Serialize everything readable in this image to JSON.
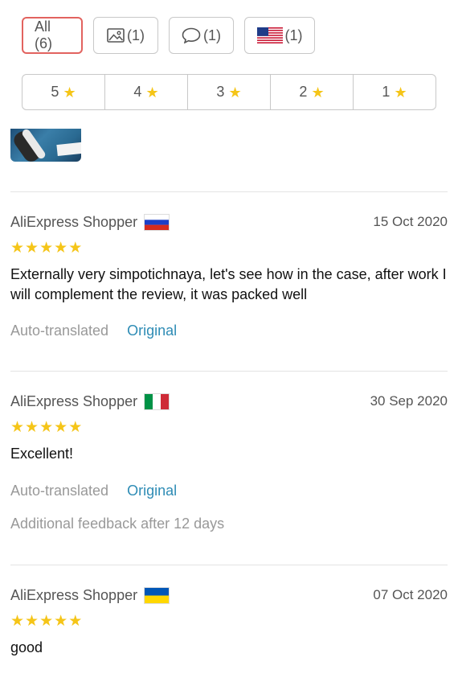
{
  "filters": {
    "all_label": "All (6)",
    "image_count": "(1)",
    "comment_count": "(1)",
    "flag_count": "(1)"
  },
  "ratings": [
    "5",
    "4",
    "3",
    "2",
    "1"
  ],
  "reviews": [
    {
      "name": "AliExpress Shopper",
      "country": "RU",
      "date": "15 Oct 2020",
      "stars": 5,
      "text": "Externally very simpotichnaya, let's see how in the case, after work I will complement the review, it was packed well",
      "auto_translated": "Auto-translated",
      "original": "Original"
    },
    {
      "name": "AliExpress Shopper",
      "country": "IT",
      "date": "30 Sep 2020",
      "stars": 5,
      "text": "Excellent!",
      "auto_translated": "Auto-translated",
      "original": "Original",
      "additional": "Additional feedback after 12 days"
    },
    {
      "name": "AliExpress Shopper",
      "country": "UA",
      "date": "07 Oct 2020",
      "stars": 5,
      "text": "good"
    }
  ],
  "colors": {
    "active_border": "#e2635f",
    "star": "#f5c518",
    "link": "#2e8cb5"
  }
}
